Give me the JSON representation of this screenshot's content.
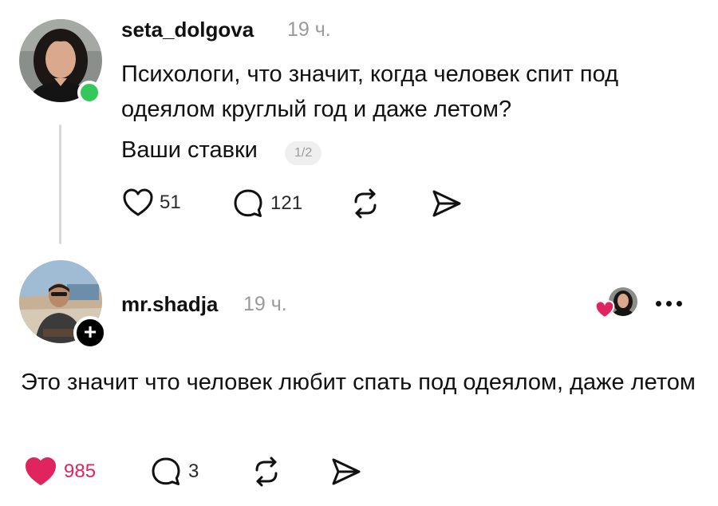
{
  "post": {
    "username": "seta_dolgova",
    "time": "19 ч.",
    "text": "Психологи, что значит, когда человек спит под одеялом круглый год и даже летом?",
    "caption": "Ваши ставки",
    "page_indicator": "1/2",
    "likes": "51",
    "replies": "121",
    "online": true
  },
  "reply": {
    "username": "mr.shadja",
    "time": "19 ч.",
    "text": "Это значит что человек любит спать под одеялом, даже летом",
    "likes": "985",
    "replies": "3",
    "liked": true
  },
  "icons": {
    "like": "heart-icon",
    "reply": "comment-bubble-icon",
    "repost": "repost-icon",
    "share": "send-icon",
    "more": "more-dots-icon",
    "follow": "plus-icon"
  },
  "colors": {
    "like_active": "#e0245e",
    "online": "#35c75a",
    "muted_text": "#9a9a9a"
  }
}
